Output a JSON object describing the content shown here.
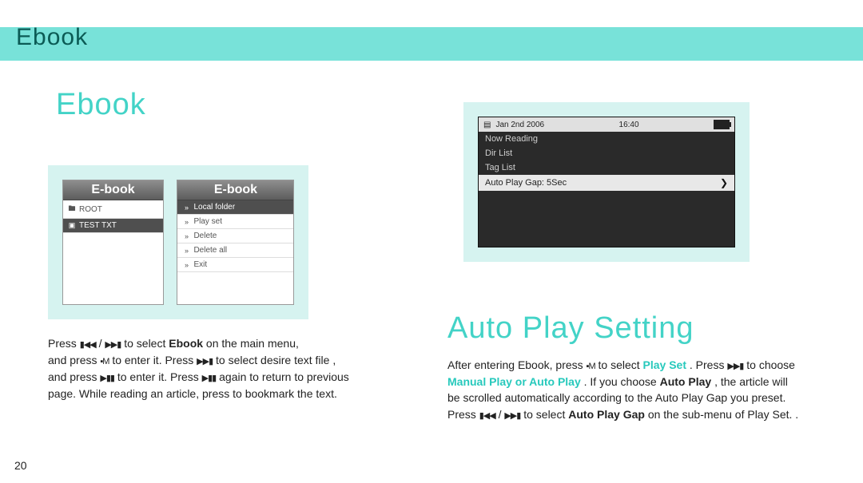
{
  "band_title": "Ebook",
  "page_number": "20",
  "left": {
    "title": "Ebook",
    "device1_header": "E-book",
    "device1_items": [
      {
        "icon": "folder",
        "label": "ROOT",
        "selected": false
      },
      {
        "icon": "file",
        "label": "TEST TXT",
        "selected": true
      }
    ],
    "device2_header": "E-book",
    "device2_items": [
      {
        "label": "Local folder",
        "selected": true
      },
      {
        "label": "Play set",
        "selected": false
      },
      {
        "label": "Delete",
        "selected": false
      },
      {
        "label": "Delete all",
        "selected": false
      },
      {
        "label": "Exit",
        "selected": false
      }
    ],
    "instr": {
      "l1a": "Press ",
      "l1b": " / ",
      "l1c": " to select ",
      "l1_bold": "Ebook",
      "l1d": " on the main menu,",
      "l2a": "and press ",
      "l2b": " to enter it. Press ",
      "l2c": " to select desire text file ,",
      "l3a": "and press ",
      "l3b": " to enter it. Press ",
      "l3c": " again to return to previous",
      "l4": "page. While reading an article, press to bookmark the text."
    }
  },
  "right": {
    "title": "Auto Play Setting",
    "status_date": "Jan 2nd 2006",
    "status_time": "16:40",
    "menu": [
      {
        "label": "Now Reading",
        "highlight": false
      },
      {
        "label": "Dir List",
        "highlight": false
      },
      {
        "label": "Tag List",
        "highlight": false
      },
      {
        "label": "Auto Play Gap: 5Sec",
        "highlight": true
      }
    ],
    "instr": {
      "l1a": "After entering Ebook, press ",
      "l1b": " to select ",
      "l1_accent1": "Play Set",
      "l1c": ". Press ",
      "l1d": " to choose",
      "l2_accent": "Manual Play or Auto Play",
      "l2a": ". If you choose ",
      "l2_bold": "Auto Play",
      "l2b": ", the article will",
      "l3": "be scrolled automatically according to the Auto Play Gap you preset.",
      "l4a": "Press ",
      "l4b": " / ",
      "l4c": " to select ",
      "l4_bold": "Auto Play Gap",
      "l4d": " on the sub-menu of Play Set. ."
    }
  },
  "icons": {
    "prev": "▮◀◀",
    "next": "▶▶▮",
    "menu": "▪M",
    "ff": "▶▶▮",
    "playpause": "▶▮▮"
  }
}
